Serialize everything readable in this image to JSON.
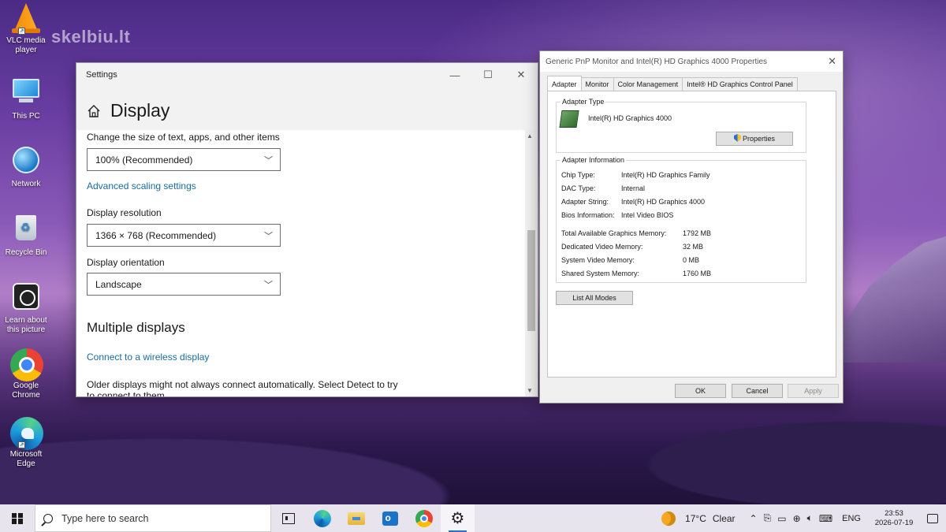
{
  "watermark": "skelbiu.lt",
  "desktop": {
    "icons": [
      {
        "label": "VLC media player",
        "icon": "vlc-icon"
      },
      {
        "label": "This PC",
        "icon": "this-pc-icon"
      },
      {
        "label": "Network",
        "icon": "network-icon"
      },
      {
        "label": "Recycle Bin",
        "icon": "recycle-bin-icon"
      },
      {
        "label": "Learn about this picture",
        "icon": "learn-about-picture-icon"
      },
      {
        "label": "Google Chrome",
        "icon": "chrome-icon"
      },
      {
        "label": "Microsoft Edge",
        "icon": "edge-icon"
      }
    ]
  },
  "settings_window": {
    "title": "Settings",
    "page_title": "Display",
    "scale_label": "Change the size of text, apps, and other items",
    "scale_value": "100% (Recommended)",
    "advanced_scaling_link": "Advanced scaling settings",
    "resolution_label": "Display resolution",
    "resolution_value": "1366 × 768 (Recommended)",
    "orientation_label": "Display orientation",
    "orientation_value": "Landscape",
    "multiple_displays_title": "Multiple displays",
    "wireless_link": "Connect to a wireless display",
    "older_displays_text": "Older displays might not always connect automatically. Select Detect to try to connect to them."
  },
  "properties_dialog": {
    "title": "Generic PnP Monitor and Intel(R) HD Graphics 4000 Properties",
    "tabs": [
      "Adapter",
      "Monitor",
      "Color Management",
      "Intel® HD Graphics Control Panel"
    ],
    "active_tab": "Adapter",
    "adapter_type_title": "Adapter Type",
    "adapter_name": "Intel(R) HD Graphics 4000",
    "properties_button": "Properties",
    "adapter_info_title": "Adapter Information",
    "info": [
      {
        "key": "Chip Type:",
        "value": "Intel(R) HD Graphics Family"
      },
      {
        "key": "DAC Type:",
        "value": "Internal"
      },
      {
        "key": "Adapter String:",
        "value": "Intel(R) HD Graphics 4000"
      },
      {
        "key": "Bios Information:",
        "value": "Intel Video BIOS"
      }
    ],
    "memory": [
      {
        "key": "Total Available Graphics Memory:",
        "value": "1792 MB"
      },
      {
        "key": "Dedicated Video Memory:",
        "value": "32 MB"
      },
      {
        "key": "System Video Memory:",
        "value": "0 MB"
      },
      {
        "key": "Shared System Memory:",
        "value": "1760 MB"
      }
    ],
    "list_all_modes_button": "List All Modes",
    "ok_button": "OK",
    "cancel_button": "Cancel",
    "apply_button": "Apply"
  },
  "taskbar": {
    "search_placeholder": "Type here to search",
    "weather_temp": "17°C",
    "weather_desc": "Clear",
    "language": "ENG",
    "time": "23:53",
    "date": "2026-07-19"
  }
}
